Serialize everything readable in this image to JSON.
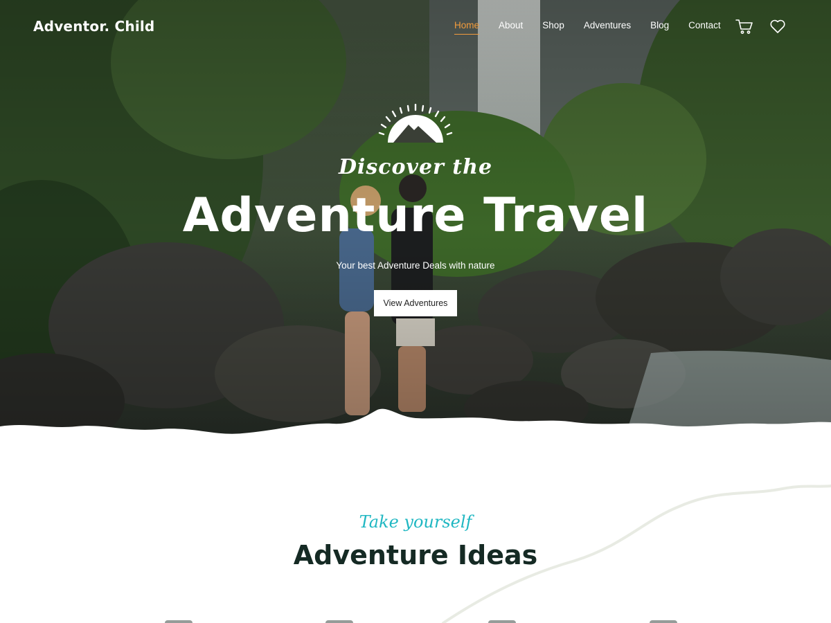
{
  "header": {
    "logo": "Adventor. Child",
    "nav": [
      {
        "label": "Home",
        "active": true
      },
      {
        "label": "About",
        "active": false
      },
      {
        "label": "Shop",
        "active": false
      },
      {
        "label": "Adventures",
        "active": false
      },
      {
        "label": "Blog",
        "active": false
      },
      {
        "label": "Contact",
        "active": false
      }
    ],
    "icons": [
      "cart-icon",
      "heart-icon"
    ]
  },
  "hero": {
    "logo_icon": "sun-mountain-icon",
    "script": "Discover the",
    "title": "Adventure Travel",
    "subtitle": "Your best Adventure Deals with nature",
    "cta_label": "View Adventures"
  },
  "section": {
    "script": "Take yourself",
    "title": "Adventure Ideas"
  },
  "colors": {
    "accent_active": "#f39c3c",
    "script_teal": "#1fb7c2",
    "title_dark": "#152a24"
  }
}
